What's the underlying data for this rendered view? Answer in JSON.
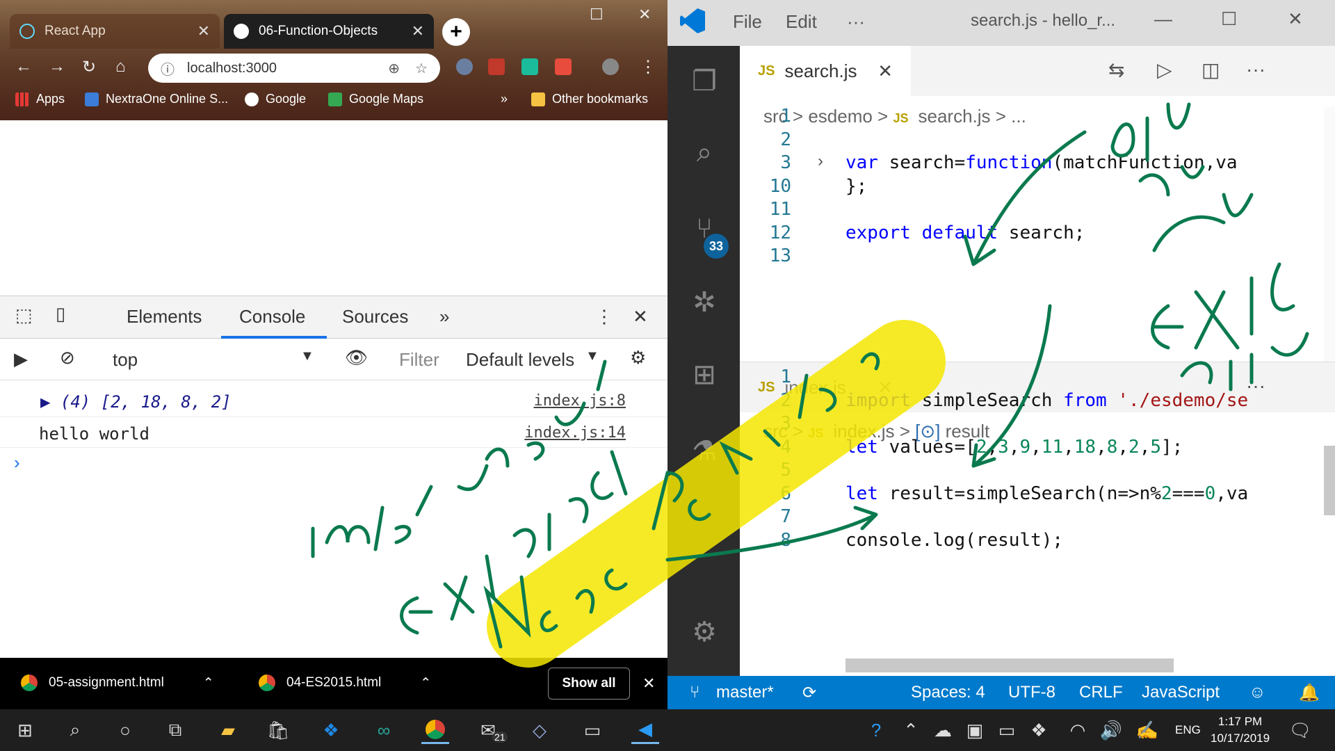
{
  "chrome": {
    "tabs": [
      {
        "title": "React App",
        "icon": "react-icon",
        "active": false
      },
      {
        "title": "06-Function-Objects",
        "icon": "globe-icon",
        "active": true
      }
    ],
    "url": "localhost:3000",
    "bookmarks": [
      {
        "label": "Apps",
        "icon": "apps-grid-icon"
      },
      {
        "label": "NextraOne Online S...",
        "icon": "nextra-icon"
      },
      {
        "label": "Google",
        "icon": "google-icon"
      },
      {
        "label": "Google Maps",
        "icon": "maps-icon"
      },
      {
        "label": "»",
        "icon": ""
      },
      {
        "label": "Other bookmarks",
        "icon": "folder-icon"
      }
    ],
    "devtools": {
      "tabs": [
        "Elements",
        "Console",
        "Sources",
        "»"
      ],
      "active_tab": "Console",
      "context": "top",
      "filter_placeholder": "Filter",
      "levels": "Default levels",
      "logs": [
        {
          "text": "▶ (4) [2, 18, 8, 2]",
          "source": "index.js:8"
        },
        {
          "text": "hello world",
          "source": "index.js:14"
        }
      ],
      "prompt": "›"
    },
    "downloads": [
      {
        "name": "05-assignment.html"
      },
      {
        "name": "04-ES2015.html"
      }
    ],
    "show_all": "Show all"
  },
  "vscode": {
    "menu": [
      "File",
      "Edit",
      "···"
    ],
    "title": "search.js - hello_r...",
    "scm_badge": "33",
    "editor1": {
      "tab": "search.js",
      "badge": "JS",
      "breadcrumb": [
        "src",
        "esdemo",
        "search.js",
        "..."
      ],
      "lines": [
        {
          "n": "1",
          "code": ""
        },
        {
          "n": "2",
          "code": ""
        },
        {
          "n": "3",
          "code": "var search=function(matchFunction,va"
        },
        {
          "n": "10",
          "code": "};"
        },
        {
          "n": "11",
          "code": ""
        },
        {
          "n": "12",
          "code": "export default search;"
        },
        {
          "n": "13",
          "code": ""
        }
      ]
    },
    "editor2": {
      "tab": "index.js",
      "badge": "JS",
      "breadcrumb": [
        "src",
        "index.js",
        "result"
      ],
      "lines": [
        {
          "n": "1",
          "code": ""
        },
        {
          "n": "2",
          "code": "import simpleSearch from './esdemo/se"
        },
        {
          "n": "3",
          "code": ""
        },
        {
          "n": "4",
          "code": "let values=[2,3,9,11,18,8,2,5];"
        },
        {
          "n": "5",
          "code": ""
        },
        {
          "n": "6",
          "code": "let result=simpleSearch(n=>n%2===0,va"
        },
        {
          "n": "7",
          "code": ""
        },
        {
          "n": "8",
          "code": "console.log(result);"
        }
      ]
    },
    "status": {
      "branch": "master*",
      "spaces": "Spaces: 4",
      "encoding": "UTF-8",
      "eol": "CRLF",
      "language": "JavaScript"
    }
  },
  "taskbar": {
    "lang": "ENG",
    "time": "1:17 PM",
    "date": "10/17/2019",
    "mail_badge": "21"
  },
  "colors": {
    "vscode_blue": "#007acc",
    "ink_green": "#0a7a4e",
    "highlighter_yellow": "#f5e600"
  }
}
